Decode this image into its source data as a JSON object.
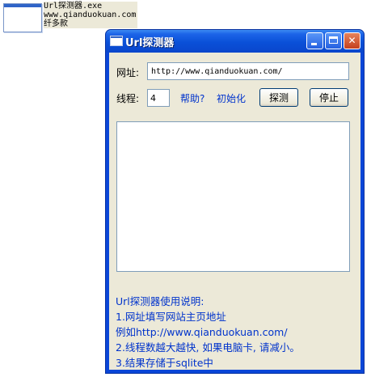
{
  "desktop": {
    "file_name": "Url探测器.exe",
    "file_company": "www.qianduokuan.com",
    "file_desc": "纤多款"
  },
  "window": {
    "title": "Url探测器",
    "url_label": "网址:",
    "url_value": "http://www.qianduokuan.com/",
    "thread_label": "线程:",
    "thread_value": "4",
    "help_link": "帮助?",
    "init_link": "初始化",
    "detect_button": "探测",
    "stop_button": "停止",
    "instructions": [
      "Url探测器使用说明:",
      "1.网址填写网站主页地址",
      "例如http://www.qianduokuan.com/",
      "2.线程数越大越快, 如果电脑卡, 请减小。",
      "3.结果存储于sqlite中"
    ]
  },
  "icons": {
    "app": "window-app-icon",
    "minimize": "minimize-icon",
    "maximize": "maximize-icon",
    "close": "close-icon"
  },
  "colors": {
    "titlebar": "#0a50d8",
    "client": "#ece9d8",
    "link": "#0033cc"
  }
}
